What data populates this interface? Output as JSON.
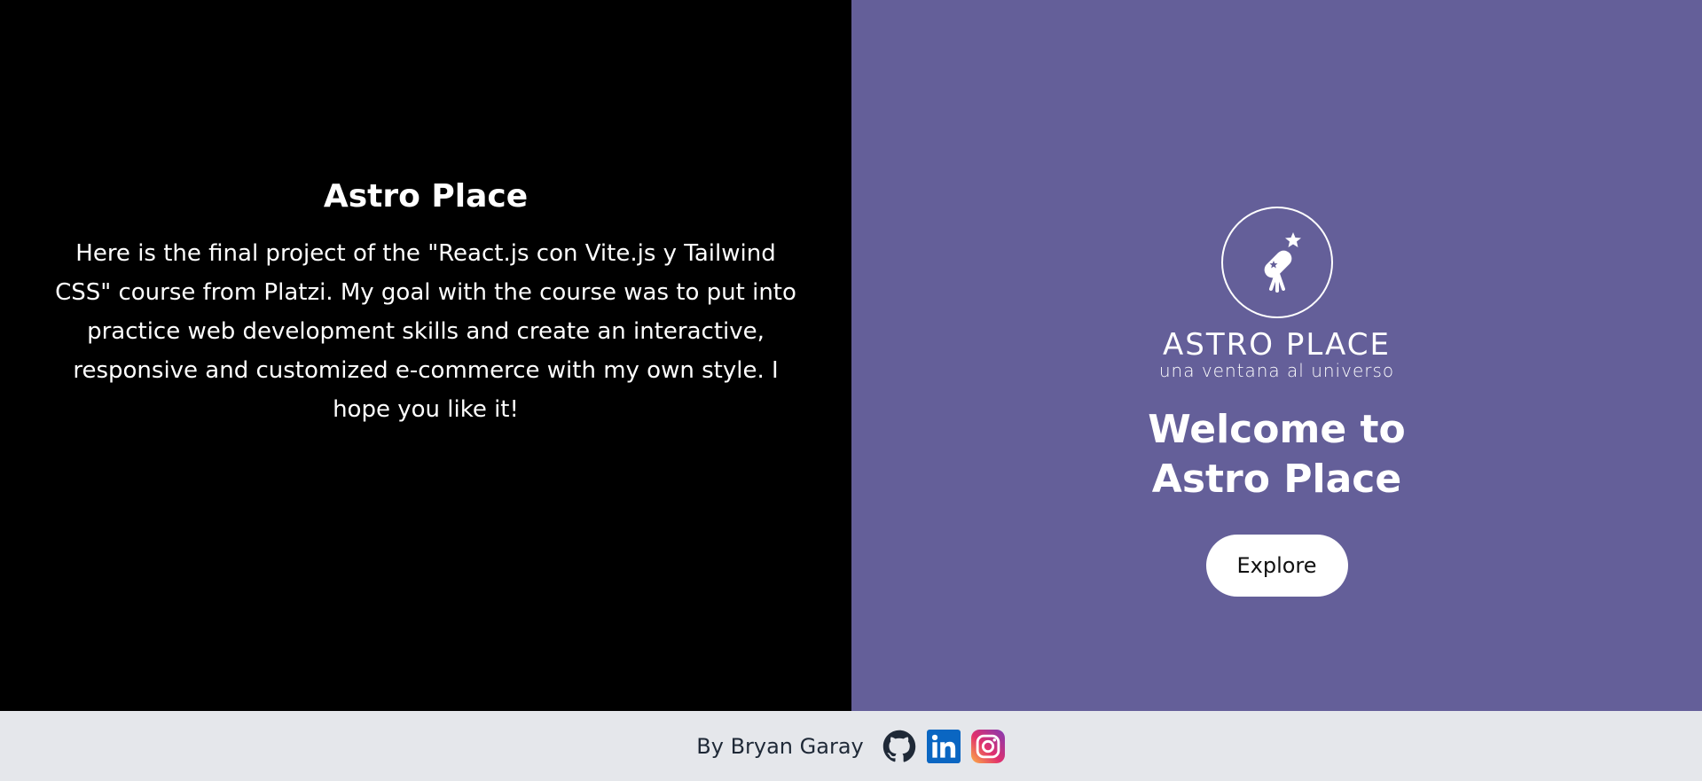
{
  "intro": {
    "title": "Astro Place",
    "description": "Here is the final project of the \"React.js con Vite.js y Tailwind CSS\" course from Platzi. My goal with the course was to put into practice web development skills and create an interactive, responsive and customized e-commerce with my own style. I hope you like it!"
  },
  "hero": {
    "logo_name": "ASTRO PLACE",
    "logo_tagline": "una ventana al universo",
    "welcome": "Welcome to Astro Place",
    "explore_label": "Explore"
  },
  "footer": {
    "byline": "By Bryan Garay",
    "icons": [
      "github-icon",
      "linkedin-icon",
      "instagram-icon"
    ]
  },
  "colors": {
    "left_bg": "#000000",
    "right_bg": "#645f99",
    "footer_bg": "#e5e7eb",
    "linkedin": "#0a66c2"
  }
}
